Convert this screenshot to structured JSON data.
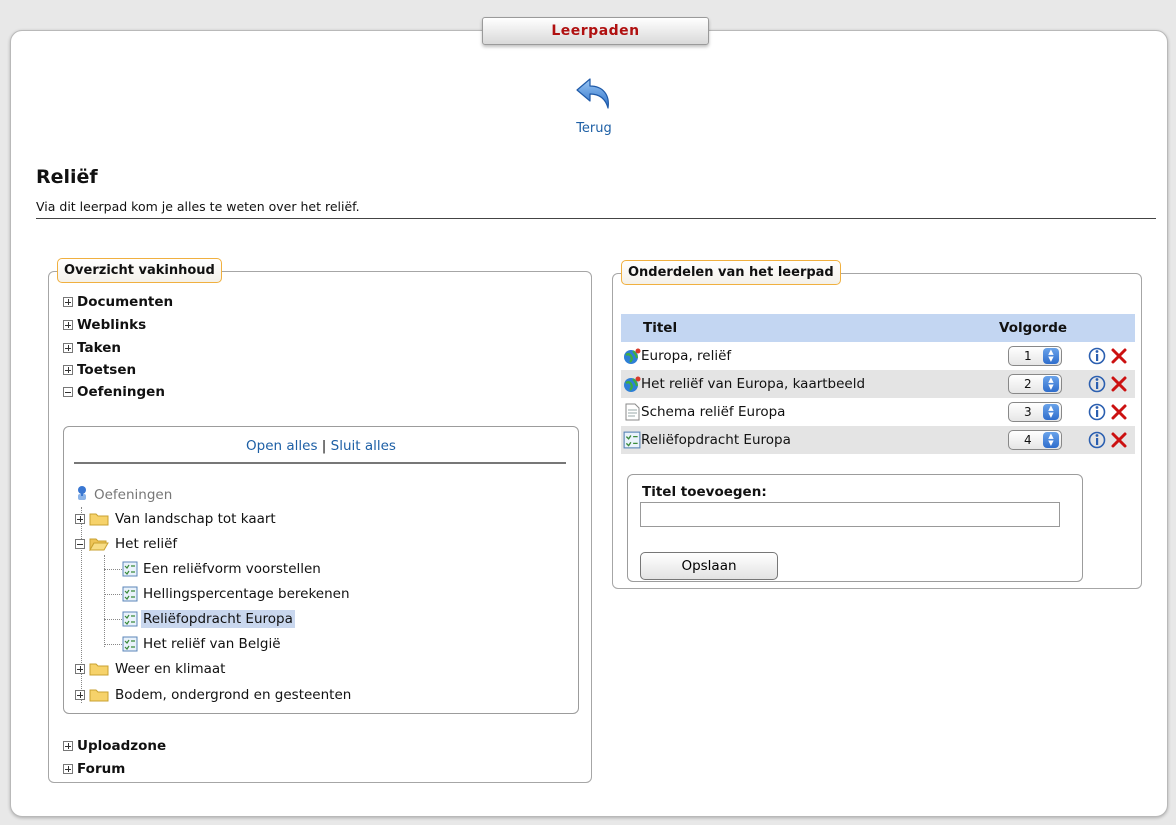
{
  "header": {
    "title": "Leerpaden"
  },
  "back": {
    "label": "Terug"
  },
  "page": {
    "title": "Reliëf",
    "description": "Via dit leerpad kom je alles te weten over het reliëf."
  },
  "left_panel": {
    "legend": "Overzicht vakinhoud",
    "categories_top": [
      "Documenten",
      "Weblinks",
      "Taken",
      "Toetsen",
      "Oefeningen"
    ],
    "open_all": "Open alles",
    "separator": "|",
    "close_all": "Sluit alles",
    "tree": {
      "root": "Oefeningen",
      "folder1": "Van landschap tot kaart",
      "folder2": "Het reliëf",
      "items": [
        "Een reliëfvorm voorstellen",
        "Hellingspercentage berekenen",
        "Reliëfopdracht Europa",
        "Het reliëf van België"
      ],
      "folder3": "Weer en klimaat",
      "folder4": "Bodem, ondergrond en gesteenten"
    },
    "categories_bottom": [
      "Uploadzone",
      "Forum"
    ]
  },
  "right_panel": {
    "legend": "Onderdelen van het leerpad",
    "col_title": "Titel",
    "col_order": "Volgorde",
    "rows": [
      {
        "title": "Europa, reliëf",
        "order": "1",
        "icon": "weblink-globe-icon"
      },
      {
        "title": "Het reliëf van Europa, kaartbeeld",
        "order": "2",
        "icon": "weblink-globe-icon"
      },
      {
        "title": "Schema reliëf Europa",
        "order": "3",
        "icon": "document-icon"
      },
      {
        "title": "Reliëfopdracht Europa",
        "order": "4",
        "icon": "exercise-icon"
      }
    ],
    "add_label": "Titel toevoegen:",
    "add_value": "",
    "save_button": "Opslaan"
  },
  "colors": {
    "title_red": "#b01010",
    "link_blue": "#1d5fa5",
    "legend_border": "#f0b040",
    "table_header": "#c3d6f2",
    "selected_row": "#c9d7ee",
    "delete_red": "#cc1111"
  }
}
